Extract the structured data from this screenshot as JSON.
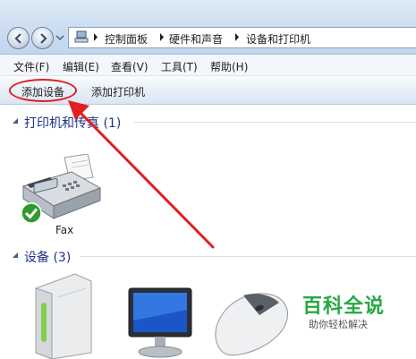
{
  "addressbar": {
    "breadcrumbs": [
      "控制面板",
      "硬件和声音",
      "设备和打印机"
    ]
  },
  "menubar": {
    "items": [
      "文件(F)",
      "编辑(E)",
      "查看(V)",
      "工具(T)",
      "帮助(H)"
    ]
  },
  "toolbar": {
    "add_device_label": "添加设备",
    "add_printer_label": "添加打印机"
  },
  "groups": {
    "printers": {
      "title": "打印机和传真 (1)",
      "devices": [
        {
          "label": "Fax",
          "status": "default"
        }
      ]
    },
    "devices": {
      "title": "设备 (3)",
      "device_icons": [
        "external-drive-icon",
        "monitor-icon",
        "mouse-icon"
      ]
    }
  },
  "annotation": {
    "highlight": "add-device-button",
    "color": "#e0201e"
  },
  "watermark": {
    "title": "百科全说",
    "subtitle": "助你轻松解决"
  },
  "colors": {
    "group_title": "#1e3287",
    "annotation_red": "#e0201e",
    "watermark_green": "#27a844"
  }
}
